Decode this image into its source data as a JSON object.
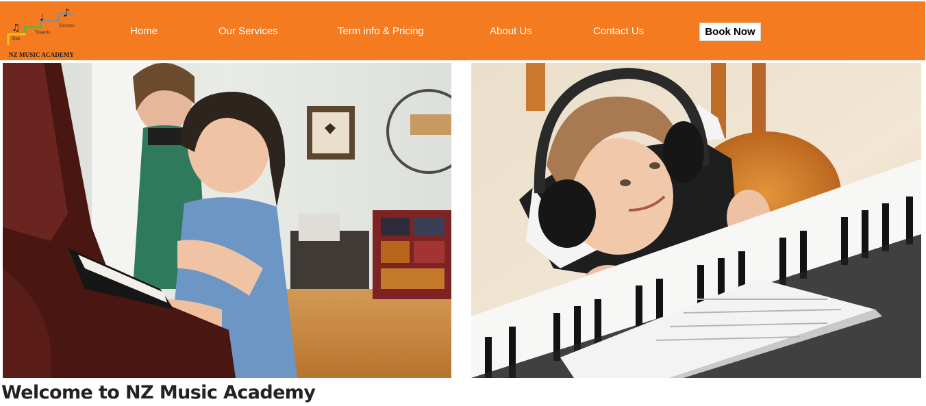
{
  "header": {
    "logo": {
      "steps": [
        "Step",
        "Towards",
        "Success"
      ],
      "name": "NZ MUSIC ACADEMY"
    },
    "nav": {
      "home": "Home",
      "services": "Our Services",
      "pricing": "Term info & Pricing",
      "about": "About Us",
      "contact": "Contact Us"
    },
    "book_label": "Book Now"
  },
  "colors": {
    "brand_orange": "#f47b20",
    "text_dark": "#222222",
    "white": "#ffffff"
  },
  "main": {
    "welcome_title": "Welcome to NZ Music Academy"
  }
}
